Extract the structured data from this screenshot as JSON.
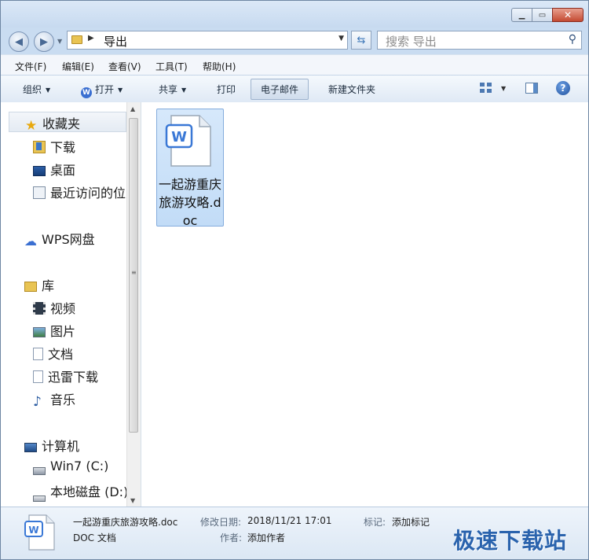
{
  "address": {
    "path": "导出",
    "search_placeholder": "搜索 导出"
  },
  "menu": [
    "文件(F)",
    "编辑(E)",
    "查看(V)",
    "工具(T)",
    "帮助(H)"
  ],
  "toolbar": {
    "organize": "组织",
    "open": "打开",
    "share": "共享",
    "print": "打印",
    "email": "电子邮件",
    "new_folder": "新建文件夹"
  },
  "nav": {
    "favorites": "收藏夹",
    "downloads": "下载",
    "desktop": "桌面",
    "recent": "最近访问的位置",
    "wps_cloud": "WPS网盘",
    "libraries": "库",
    "videos": "视频",
    "pictures": "图片",
    "documents": "文档",
    "thunder": "迅雷下载",
    "music": "音乐",
    "computer": "计算机",
    "drive_c": "Win7 (C:)",
    "drive_d": "本地磁盘 (D:)"
  },
  "files": [
    {
      "name": "一起游重庆旅游攻略.doc",
      "icon_letter": "W"
    }
  ],
  "details": {
    "filename": "一起游重庆旅游攻略.doc",
    "type": "DOC 文档",
    "modified_label": "修改日期:",
    "modified_value": "2018/11/21 17:01",
    "tags_label": "标记:",
    "tags_value": "添加标记",
    "author_label": "作者:",
    "author_value": "添加作者"
  },
  "watermark": "极速下载站",
  "colors": {
    "accent": "#3a6fd1",
    "selection": "#c8def8",
    "watermark": "#2a63ad"
  }
}
